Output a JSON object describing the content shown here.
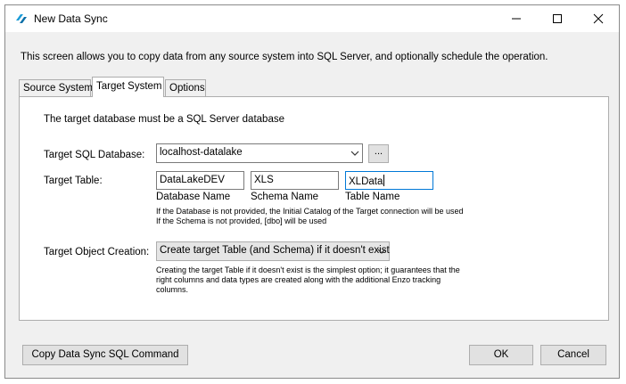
{
  "window": {
    "title": "New Data Sync",
    "icon": "app-logo-icon",
    "controls": {
      "minimize": "minimize-icon",
      "maximize": "maximize-icon",
      "close": "close-icon"
    }
  },
  "description": "This screen allows you to copy data from any source system into SQL Server, and optionally schedule the operation.",
  "tabs": [
    {
      "label": "Source System",
      "active": false
    },
    {
      "label": "Target System",
      "active": true
    },
    {
      "label": "Options",
      "active": false
    }
  ],
  "target": {
    "intro": "The target database must be a SQL Server database",
    "database_label": "Target SQL Database:",
    "database_value": "localhost-datalake",
    "browse_label": "...",
    "table_label": "Target Table:",
    "database_name": {
      "value": "DataLakeDEV",
      "caption": "Database Name"
    },
    "schema_name": {
      "value": "XLS",
      "caption": "Schema Name"
    },
    "table_name": {
      "value": "XLData",
      "caption": "Table Name"
    },
    "note_lines": [
      "If the Database is not provided, the Initial Catalog of the Target connection will be used",
      "If the Schema is not provided, [dbo] will be used"
    ],
    "creation_label": "Target Object Creation:",
    "creation_value": "Create target Table (and Schema) if it doesn't exist",
    "creation_help_lines": [
      "Creating the target Table if it doesn't exist is the simplest option; it guarantees that the",
      "right columns and data types are created along with the additional Enzo tracking",
      "columns."
    ]
  },
  "footer": {
    "copy_command_label": "Copy Data Sync SQL Command",
    "ok_label": "OK",
    "cancel_label": "Cancel"
  }
}
